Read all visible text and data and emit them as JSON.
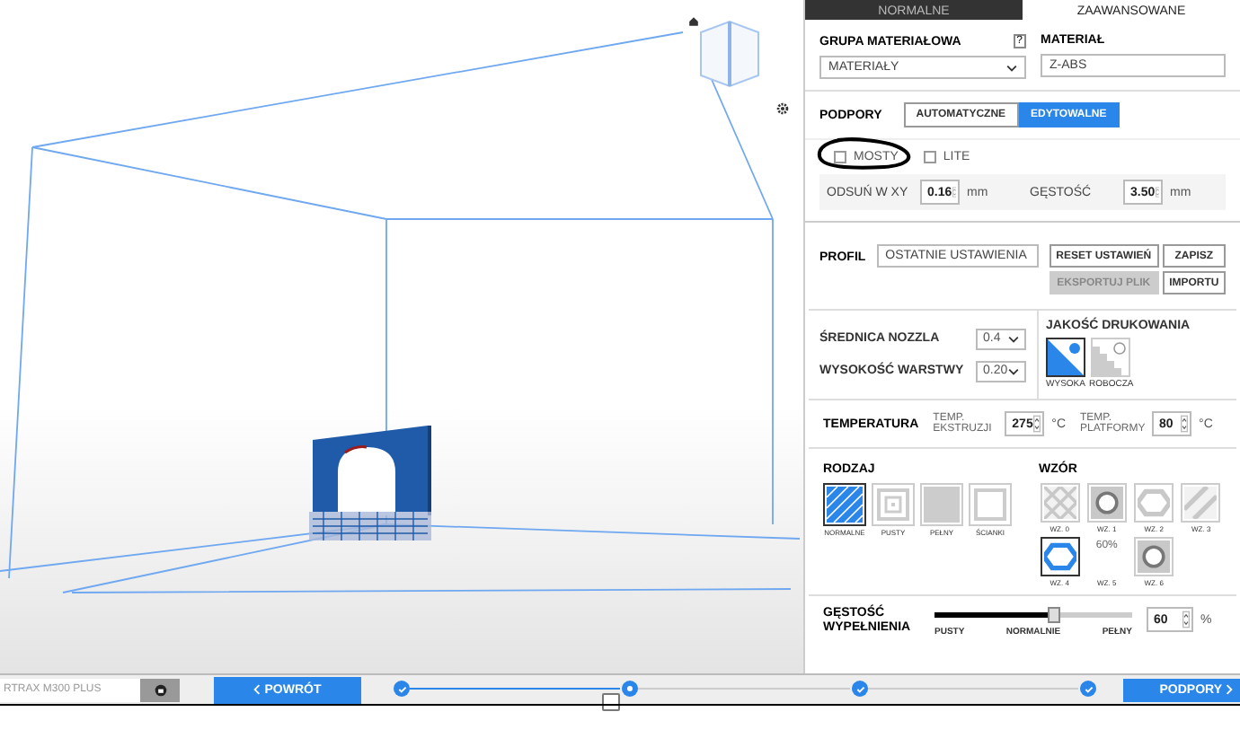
{
  "tabs": [
    {
      "label": "NORMALNE",
      "selected": false
    },
    {
      "label": "ZAAWANSOWANE",
      "selected": true
    }
  ],
  "material": {
    "group_label": "GRUPA MATERIAŁOWA",
    "help": "?",
    "group_value": "MATERIAŁY",
    "material_label": "MATERIAŁ",
    "material_value": "Z-ABS"
  },
  "supports": {
    "label": "PODPORY",
    "modes": [
      {
        "label": "AUTOMATYCZNE",
        "selected": false
      },
      {
        "label": "EDYTOWALNE",
        "selected": true
      }
    ],
    "checkboxes": [
      {
        "label": "MOSTY",
        "checked": false
      },
      {
        "label": "LITE",
        "checked": false
      }
    ],
    "fields": [
      {
        "label": "ODSUŃ W XY",
        "value": "0.16",
        "unit": "mm"
      },
      {
        "label": "GĘSTOŚĆ",
        "value": "3.50",
        "unit": "mm"
      }
    ]
  },
  "profile": {
    "label": "PROFIL",
    "value": "OSTATNIE USTAWIENIA",
    "buttons": [
      {
        "label": "RESET USTAWIEŃ",
        "disabled": false
      },
      {
        "label": "ZAPISZ",
        "disabled": false
      },
      {
        "label": "EKSPORTUJ PLIK",
        "disabled": true
      },
      {
        "label": "IMPORTU",
        "disabled": false
      }
    ]
  },
  "nozzle": {
    "label": "ŚREDNICA NOZZLA",
    "value": "0.4"
  },
  "layer": {
    "label": "WYSOKOŚĆ WARSTWY",
    "value": "0.20"
  },
  "quality": {
    "label": "JAKOŚĆ DRUKOWANIA",
    "options": [
      {
        "label": "WYSOKA",
        "selected": true
      },
      {
        "label": "ROBOCZA",
        "selected": false
      }
    ]
  },
  "temperature": {
    "label": "TEMPERATURA",
    "fields": [
      {
        "label": "TEMP. EKSTRUZJI",
        "value": "275",
        "unit": "°C"
      },
      {
        "label": "TEMP. PLATFORMY",
        "value": "80",
        "unit": "°C"
      }
    ]
  },
  "infill_type": {
    "label": "RODZAJ",
    "options": [
      {
        "label": "NORMALNE",
        "kind": "hatched",
        "selected": true
      },
      {
        "label": "PUSTY",
        "kind": "hollow",
        "selected": false
      },
      {
        "label": "PEŁNY",
        "kind": "solid",
        "selected": false
      },
      {
        "label": "ŚCIANKI",
        "kind": "walls",
        "selected": false
      }
    ]
  },
  "pattern": {
    "label": "WZÓR",
    "options": [
      {
        "label": "WZ. 0",
        "kind": "diamonds",
        "selected": false
      },
      {
        "label": "WZ. 1",
        "kind": "ring",
        "selected": false
      },
      {
        "label": "WZ. 2",
        "kind": "hexagon",
        "selected": false
      },
      {
        "label": "WZ. 3",
        "kind": "stripes",
        "selected": false
      },
      {
        "label": "WZ. 4",
        "kind": "hexagon",
        "selected": true
      },
      {
        "label": "WZ. 5",
        "kind": "text",
        "text": "60%",
        "selected": false
      },
      {
        "label": "WZ. 6",
        "kind": "ring",
        "selected": false
      }
    ]
  },
  "density": {
    "label": "GĘSTOŚĆ WYPEŁNIENIA",
    "level": 0.6,
    "value": "60",
    "unit": "%",
    "marks": [
      "PUSTY",
      "NORMALNIE",
      "PEŁNY"
    ]
  },
  "bottom": {
    "printer": "RTRAX M300 PLUS",
    "back": "POWRÓT",
    "next": "PODPORY",
    "steps": [
      {
        "kind": "done"
      },
      {
        "kind": "current"
      },
      {
        "kind": "done"
      },
      {
        "kind": "done"
      }
    ]
  }
}
